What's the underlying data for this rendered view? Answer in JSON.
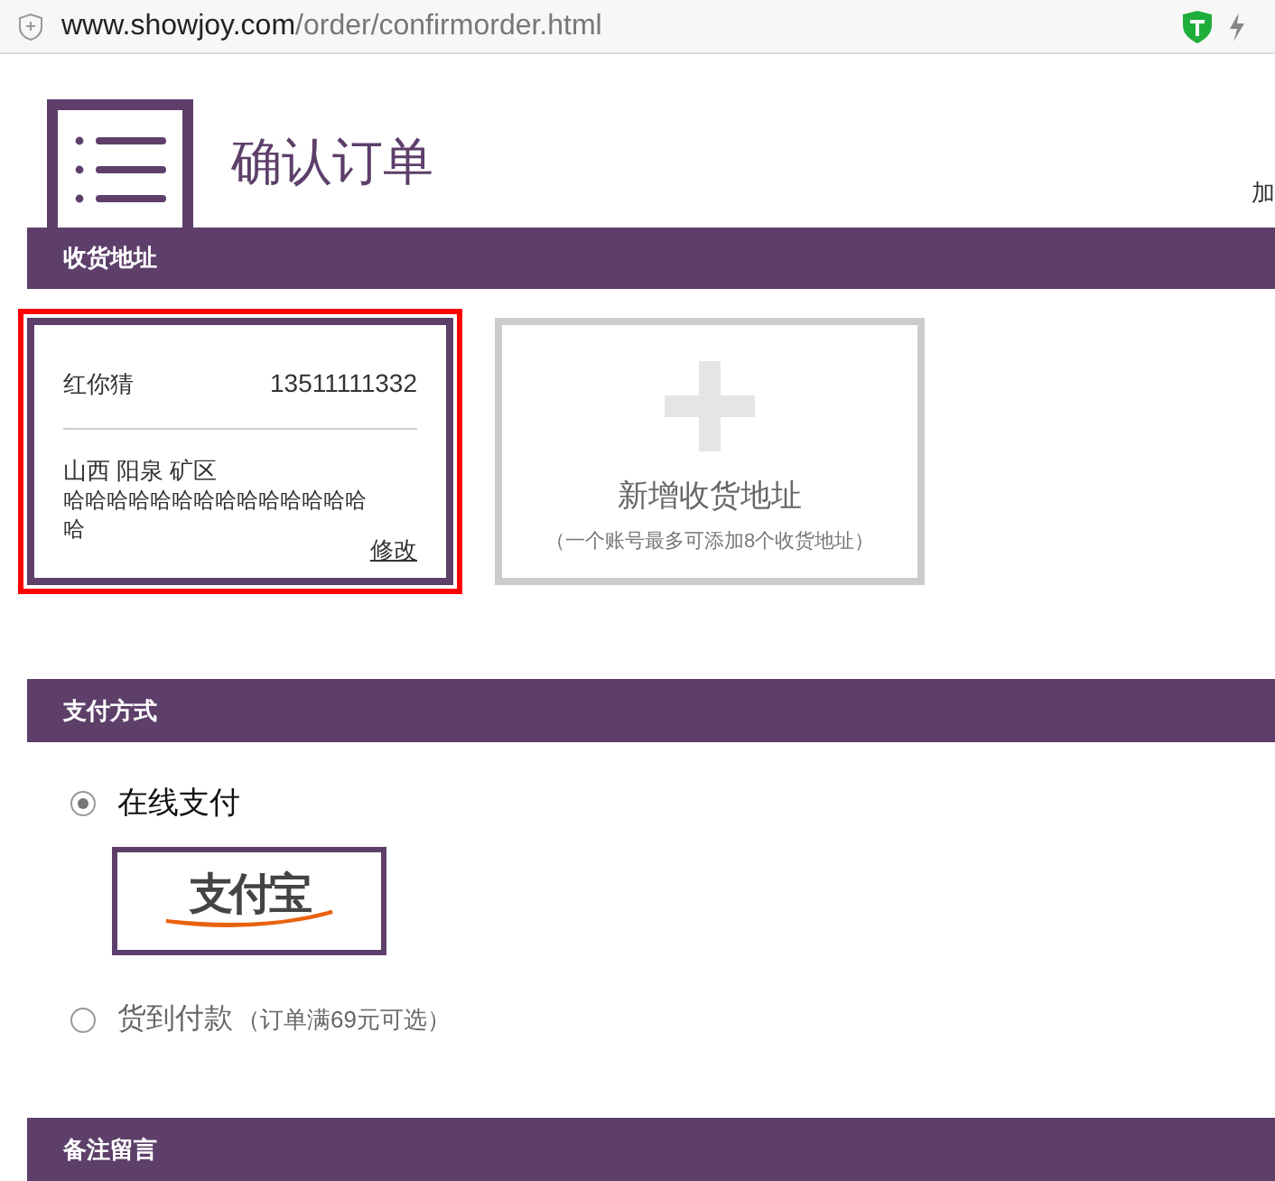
{
  "browser": {
    "url_host": "www.showjoy.com",
    "url_path": "/order/confirmorder.html"
  },
  "header": {
    "title": "确认订单",
    "right_text": "加"
  },
  "address_section": {
    "title": "收货地址",
    "addresses": [
      {
        "name": "红你猜",
        "phone": "13511111332",
        "region": "山西 阳泉 矿区",
        "detail": "哈哈哈哈哈哈哈哈哈哈哈哈哈哈哈",
        "edit_link": "修改",
        "selected": true
      }
    ],
    "add_card": {
      "label": "新增收货地址",
      "note": "（一个账号最多可添加8个收货地址）"
    }
  },
  "payment_section": {
    "title": "支付方式",
    "options": [
      {
        "label": "在线支付",
        "logo_text": "支付宝",
        "selected": true
      },
      {
        "label": "货到付款",
        "note": "（订单满69元可选）",
        "selected": false
      }
    ]
  },
  "remark_section": {
    "title": "备注留言"
  }
}
